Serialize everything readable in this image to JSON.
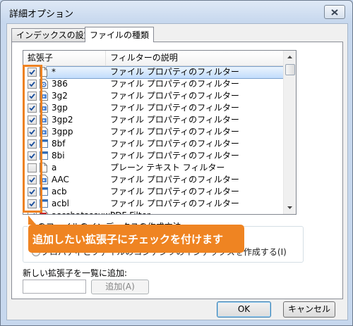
{
  "window": {
    "title": "詳細オプション"
  },
  "tabs": [
    {
      "label": "インデックスの設定",
      "active": false
    },
    {
      "label": "ファイルの種類",
      "active": true
    }
  ],
  "list": {
    "headers": {
      "extension": "拡張子",
      "description": "フィルターの説明"
    },
    "rows": [
      {
        "ext": "*",
        "desc": "ファイル プロパティのフィルター",
        "checked": true,
        "icon": "blank-file-icon",
        "selected": true
      },
      {
        "ext": "386",
        "desc": "ファイル プロパティのフィルター",
        "checked": true,
        "icon": "system-file-icon"
      },
      {
        "ext": "3g2",
        "desc": "ファイル プロパティのフィルター",
        "checked": true,
        "icon": "media-file-icon"
      },
      {
        "ext": "3gp",
        "desc": "ファイル プロパティのフィルター",
        "checked": true,
        "icon": "media-file-icon"
      },
      {
        "ext": "3gp2",
        "desc": "ファイル プロパティのフィルター",
        "checked": true,
        "icon": "media-file-icon"
      },
      {
        "ext": "3gpp",
        "desc": "ファイル プロパティのフィルター",
        "checked": true,
        "icon": "media-file-icon"
      },
      {
        "ext": "8bf",
        "desc": "ファイル プロパティのフィルター",
        "checked": true,
        "icon": "app-file-icon"
      },
      {
        "ext": "8bi",
        "desc": "ファイル プロパティのフィルター",
        "checked": true,
        "icon": "app-file-icon"
      },
      {
        "ext": "a",
        "desc": "プレーン テキスト フィルター",
        "checked": false,
        "icon": "blank-file-icon"
      },
      {
        "ext": "AAC",
        "desc": "ファイル プロパティのフィルター",
        "checked": true,
        "icon": "media-file-icon"
      },
      {
        "ext": "acb",
        "desc": "ファイル プロパティのフィルター",
        "checked": true,
        "icon": "app-file-icon"
      },
      {
        "ext": "acbl",
        "desc": "ファイル プロパティのフィルター",
        "checked": true,
        "icon": "app-file-icon"
      },
      {
        "ext": "ascshatsccuwi",
        "desc": "PDF Filter",
        "checked": true,
        "icon": "pdf-file-icon"
      }
    ]
  },
  "callout": {
    "text": "追加したい拡張子にチェックを付けます"
  },
  "indexing_group": {
    "label": "このファイルのインデックスの作成方法",
    "option_visible_text": "プロパティとファイルのコンテンツのインデックスを作成する(I)"
  },
  "add": {
    "label": "新しい拡張子を一覧に追加:",
    "input_value": "",
    "button_label": "追加(A)"
  },
  "buttons": {
    "ok": "OK",
    "cancel": "キャンセル"
  },
  "colors": {
    "accent": "#ef8422",
    "check": "#1b4f9c"
  }
}
